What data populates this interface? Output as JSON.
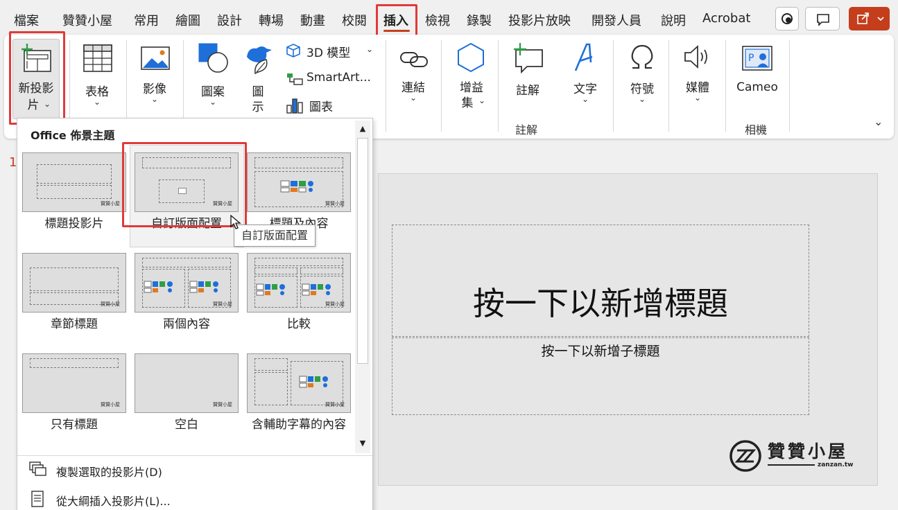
{
  "menu": {
    "tabs": [
      "檔案",
      "贊贊小屋",
      "常用",
      "繪圖",
      "設計",
      "轉場",
      "動畫",
      "校閱",
      "插入",
      "檢視",
      "錄製",
      "投影片放映",
      "開發人員",
      "說明",
      "Acrobat"
    ],
    "active": "插入"
  },
  "ribbon": {
    "new_slide": {
      "line1": "新投影",
      "line2": "片"
    },
    "table": "表格",
    "image": "影像",
    "shapes": "圖案",
    "icons": {
      "line1": "圖",
      "line2": "示"
    },
    "model_3d": "3D 模型",
    "smartart": "SmartArt...",
    "chart": "圖表",
    "links": "連結",
    "addins": {
      "line1": "增益",
      "line2": "集"
    },
    "comment": "註解",
    "comment_group": "註解",
    "text": "文字",
    "symbols": "符號",
    "media": "媒體",
    "cameo": "Cameo",
    "camera_group": "相機"
  },
  "panel": {
    "heading": "Office 佈景主題",
    "layouts": [
      "標題投影片",
      "自訂版面配置",
      "標題及內容",
      "章節標題",
      "兩個內容",
      "比較",
      "只有標題",
      "空白",
      "含輔助字幕的內容"
    ],
    "tooltip": "自訂版面配置",
    "watermark": "贊贊小屋",
    "duplicate": "複製選取的投影片(D)",
    "from_outline": "從大綱插入投影片(L)..."
  },
  "slide": {
    "number": "1",
    "title_placeholder": "按一下以新增標題",
    "subtitle_placeholder": "按一下以新增子標題",
    "logo_text": "贊贊小屋",
    "logo_sub": "zanzan.tw"
  },
  "colors": {
    "accent": "#c43e1c",
    "highlight_box": "#e03a3a",
    "icon_blue": "#1e6fd9"
  }
}
